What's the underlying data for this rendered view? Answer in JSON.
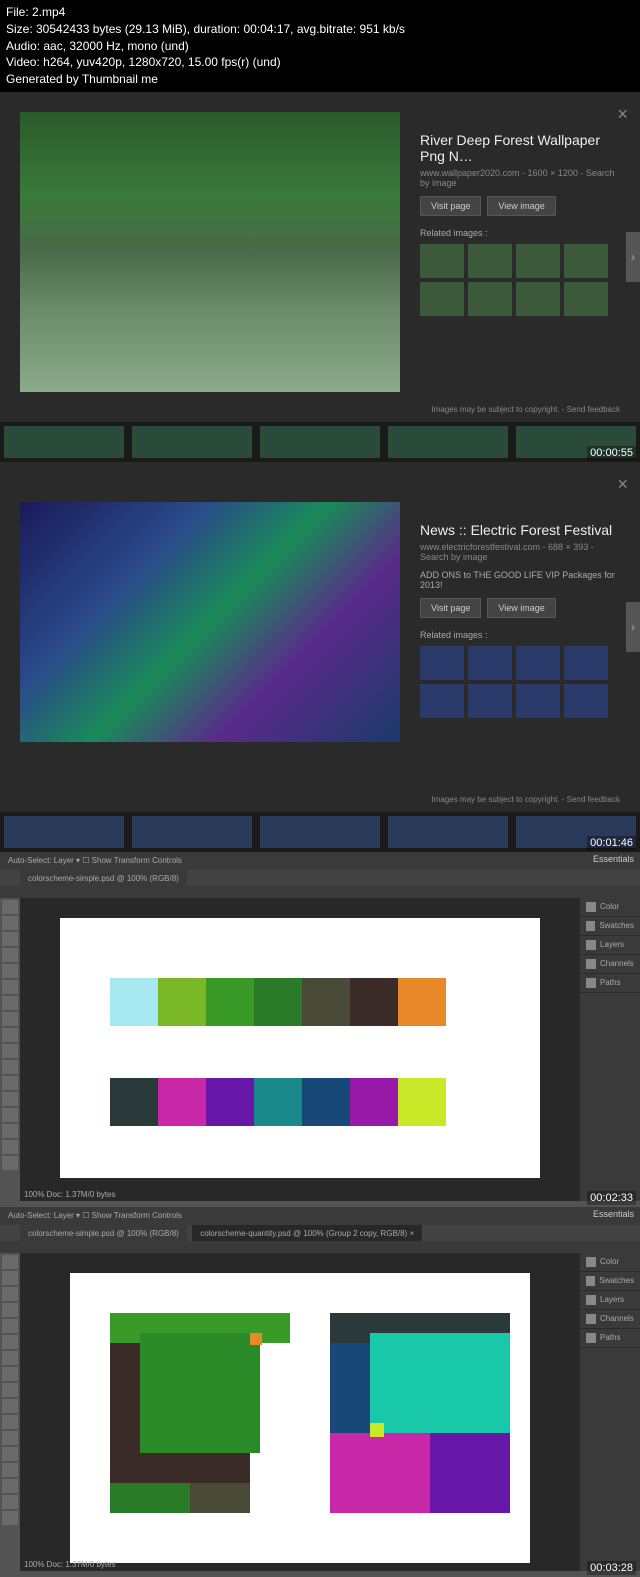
{
  "header": {
    "file": "File: 2.mp4",
    "size": "Size: 30542433 bytes (29.13 MiB), duration: 00:04:17, avg.bitrate: 951 kb/s",
    "audio": "Audio: aac, 32000 Hz, mono (und)",
    "video": "Video: h264, yuv420p, 1280x720, 15.00 fps(r) (und)",
    "gen": "Generated by Thumbnail me"
  },
  "frame1": {
    "title": "River Deep Forest Wallpaper Png N…",
    "meta": "www.wallpaper2020.com  -  1600 × 1200  -  Search by image",
    "visit": "Visit page",
    "view": "View image",
    "related": "Related images :",
    "footer": "Images may be subject to copyright.  -  Send feedback",
    "ts": "00:00:55"
  },
  "frame2": {
    "title": "News :: Electric Forest Festival",
    "meta": "www.electricforestfestival.com  -  688 × 393  -  Search by image",
    "desc": "ADD ONS to THE GOOD LIFE VIP Packages for 2013!",
    "visit": "Visit page",
    "view": "View image",
    "related": "Related images :",
    "footer": "Images may be subject to copyright.  -  Send feedback",
    "ts": "00:01:46"
  },
  "frame3": {
    "tab": "colorscheme-simple.psd @ 100% (RGB/8)",
    "opts": "Auto-Select:  Layer  ▾   ☐ Show Transform Controls",
    "essentials": "Essentials",
    "panels": {
      "color": "Color",
      "swatches": "Swatches",
      "layers": "Layers",
      "channels": "Channels",
      "paths": "Paths"
    },
    "status": "100%     Doc: 1.37M/0 bytes",
    "ts": "00:02:33"
  },
  "frame4": {
    "tab1": "colorscheme-simple.psd @ 100% (RGB/8)",
    "tab2": "colorscheme-quantity.psd @ 100% (Group 2 copy, RGB/8) ×",
    "opts": "Auto-Select:  Layer  ▾   ☐ Show Transform Controls",
    "essentials": "Essentials",
    "panels": {
      "color": "Color",
      "swatches": "Swatches",
      "layers": "Layers",
      "channels": "Channels",
      "paths": "Paths"
    },
    "status": "100%     Doc: 1.37M/0 bytes",
    "ts": "00:03:28"
  }
}
